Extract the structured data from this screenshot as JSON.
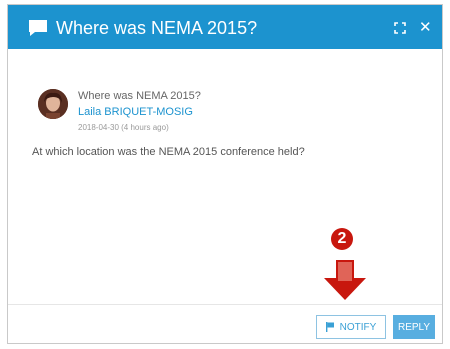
{
  "dialog": {
    "title": "Where was NEMA 2015?",
    "icons": {
      "header": "chat-bubble-icon",
      "expand": "expand-icon",
      "close": "close-icon"
    }
  },
  "post": {
    "question_title": "Where was NEMA 2015?",
    "author": "Laila BRIQUET-MOSIG",
    "timestamp": "2018-04-30 (4 hours ago)",
    "body": "At which location was the NEMA 2015 conference held?"
  },
  "footer": {
    "notify_label": "NOTIFY",
    "reply_label": "REPLY"
  },
  "annotation": {
    "step": "2",
    "color": "#c8170e"
  },
  "colors": {
    "header": "#1c93cf",
    "accent": "#1c93cf"
  }
}
